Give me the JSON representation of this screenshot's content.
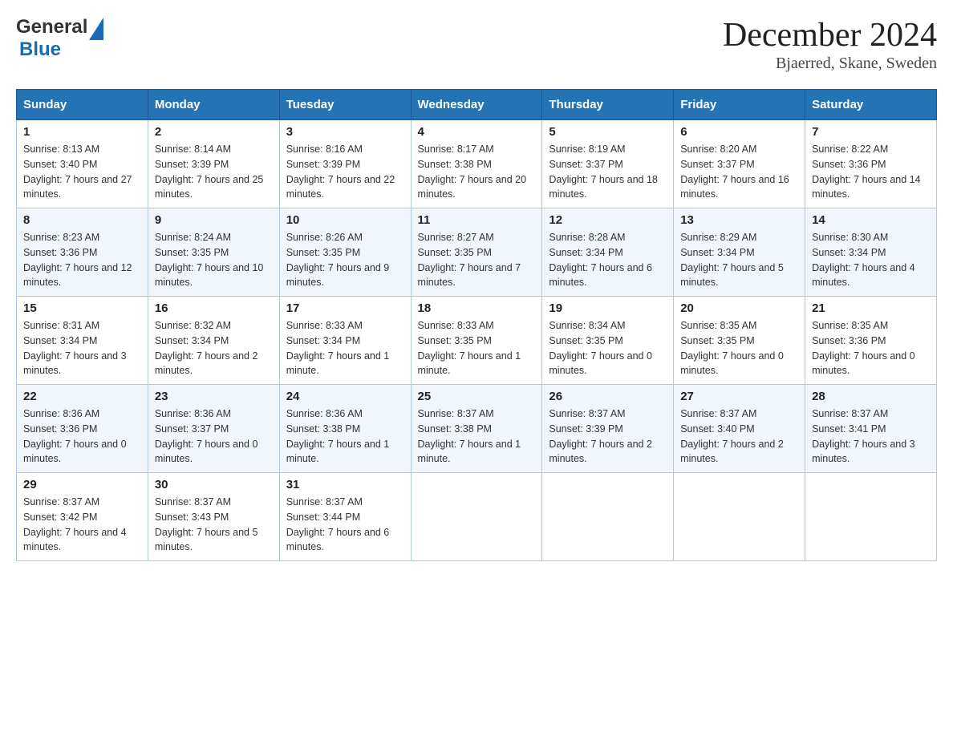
{
  "header": {
    "logo_general": "General",
    "logo_blue": "Blue",
    "month_year": "December 2024",
    "location": "Bjaerred, Skane, Sweden"
  },
  "days_of_week": [
    "Sunday",
    "Monday",
    "Tuesday",
    "Wednesday",
    "Thursday",
    "Friday",
    "Saturday"
  ],
  "weeks": [
    [
      {
        "day": "1",
        "sunrise": "8:13 AM",
        "sunset": "3:40 PM",
        "daylight": "7 hours and 27 minutes."
      },
      {
        "day": "2",
        "sunrise": "8:14 AM",
        "sunset": "3:39 PM",
        "daylight": "7 hours and 25 minutes."
      },
      {
        "day": "3",
        "sunrise": "8:16 AM",
        "sunset": "3:39 PM",
        "daylight": "7 hours and 22 minutes."
      },
      {
        "day": "4",
        "sunrise": "8:17 AM",
        "sunset": "3:38 PM",
        "daylight": "7 hours and 20 minutes."
      },
      {
        "day": "5",
        "sunrise": "8:19 AM",
        "sunset": "3:37 PM",
        "daylight": "7 hours and 18 minutes."
      },
      {
        "day": "6",
        "sunrise": "8:20 AM",
        "sunset": "3:37 PM",
        "daylight": "7 hours and 16 minutes."
      },
      {
        "day": "7",
        "sunrise": "8:22 AM",
        "sunset": "3:36 PM",
        "daylight": "7 hours and 14 minutes."
      }
    ],
    [
      {
        "day": "8",
        "sunrise": "8:23 AM",
        "sunset": "3:36 PM",
        "daylight": "7 hours and 12 minutes."
      },
      {
        "day": "9",
        "sunrise": "8:24 AM",
        "sunset": "3:35 PM",
        "daylight": "7 hours and 10 minutes."
      },
      {
        "day": "10",
        "sunrise": "8:26 AM",
        "sunset": "3:35 PM",
        "daylight": "7 hours and 9 minutes."
      },
      {
        "day": "11",
        "sunrise": "8:27 AM",
        "sunset": "3:35 PM",
        "daylight": "7 hours and 7 minutes."
      },
      {
        "day": "12",
        "sunrise": "8:28 AM",
        "sunset": "3:34 PM",
        "daylight": "7 hours and 6 minutes."
      },
      {
        "day": "13",
        "sunrise": "8:29 AM",
        "sunset": "3:34 PM",
        "daylight": "7 hours and 5 minutes."
      },
      {
        "day": "14",
        "sunrise": "8:30 AM",
        "sunset": "3:34 PM",
        "daylight": "7 hours and 4 minutes."
      }
    ],
    [
      {
        "day": "15",
        "sunrise": "8:31 AM",
        "sunset": "3:34 PM",
        "daylight": "7 hours and 3 minutes."
      },
      {
        "day": "16",
        "sunrise": "8:32 AM",
        "sunset": "3:34 PM",
        "daylight": "7 hours and 2 minutes."
      },
      {
        "day": "17",
        "sunrise": "8:33 AM",
        "sunset": "3:34 PM",
        "daylight": "7 hours and 1 minute."
      },
      {
        "day": "18",
        "sunrise": "8:33 AM",
        "sunset": "3:35 PM",
        "daylight": "7 hours and 1 minute."
      },
      {
        "day": "19",
        "sunrise": "8:34 AM",
        "sunset": "3:35 PM",
        "daylight": "7 hours and 0 minutes."
      },
      {
        "day": "20",
        "sunrise": "8:35 AM",
        "sunset": "3:35 PM",
        "daylight": "7 hours and 0 minutes."
      },
      {
        "day": "21",
        "sunrise": "8:35 AM",
        "sunset": "3:36 PM",
        "daylight": "7 hours and 0 minutes."
      }
    ],
    [
      {
        "day": "22",
        "sunrise": "8:36 AM",
        "sunset": "3:36 PM",
        "daylight": "7 hours and 0 minutes."
      },
      {
        "day": "23",
        "sunrise": "8:36 AM",
        "sunset": "3:37 PM",
        "daylight": "7 hours and 0 minutes."
      },
      {
        "day": "24",
        "sunrise": "8:36 AM",
        "sunset": "3:38 PM",
        "daylight": "7 hours and 1 minute."
      },
      {
        "day": "25",
        "sunrise": "8:37 AM",
        "sunset": "3:38 PM",
        "daylight": "7 hours and 1 minute."
      },
      {
        "day": "26",
        "sunrise": "8:37 AM",
        "sunset": "3:39 PM",
        "daylight": "7 hours and 2 minutes."
      },
      {
        "day": "27",
        "sunrise": "8:37 AM",
        "sunset": "3:40 PM",
        "daylight": "7 hours and 2 minutes."
      },
      {
        "day": "28",
        "sunrise": "8:37 AM",
        "sunset": "3:41 PM",
        "daylight": "7 hours and 3 minutes."
      }
    ],
    [
      {
        "day": "29",
        "sunrise": "8:37 AM",
        "sunset": "3:42 PM",
        "daylight": "7 hours and 4 minutes."
      },
      {
        "day": "30",
        "sunrise": "8:37 AM",
        "sunset": "3:43 PM",
        "daylight": "7 hours and 5 minutes."
      },
      {
        "day": "31",
        "sunrise": "8:37 AM",
        "sunset": "3:44 PM",
        "daylight": "7 hours and 6 minutes."
      },
      null,
      null,
      null,
      null
    ]
  ],
  "labels": {
    "sunrise": "Sunrise:",
    "sunset": "Sunset:",
    "daylight": "Daylight:"
  }
}
